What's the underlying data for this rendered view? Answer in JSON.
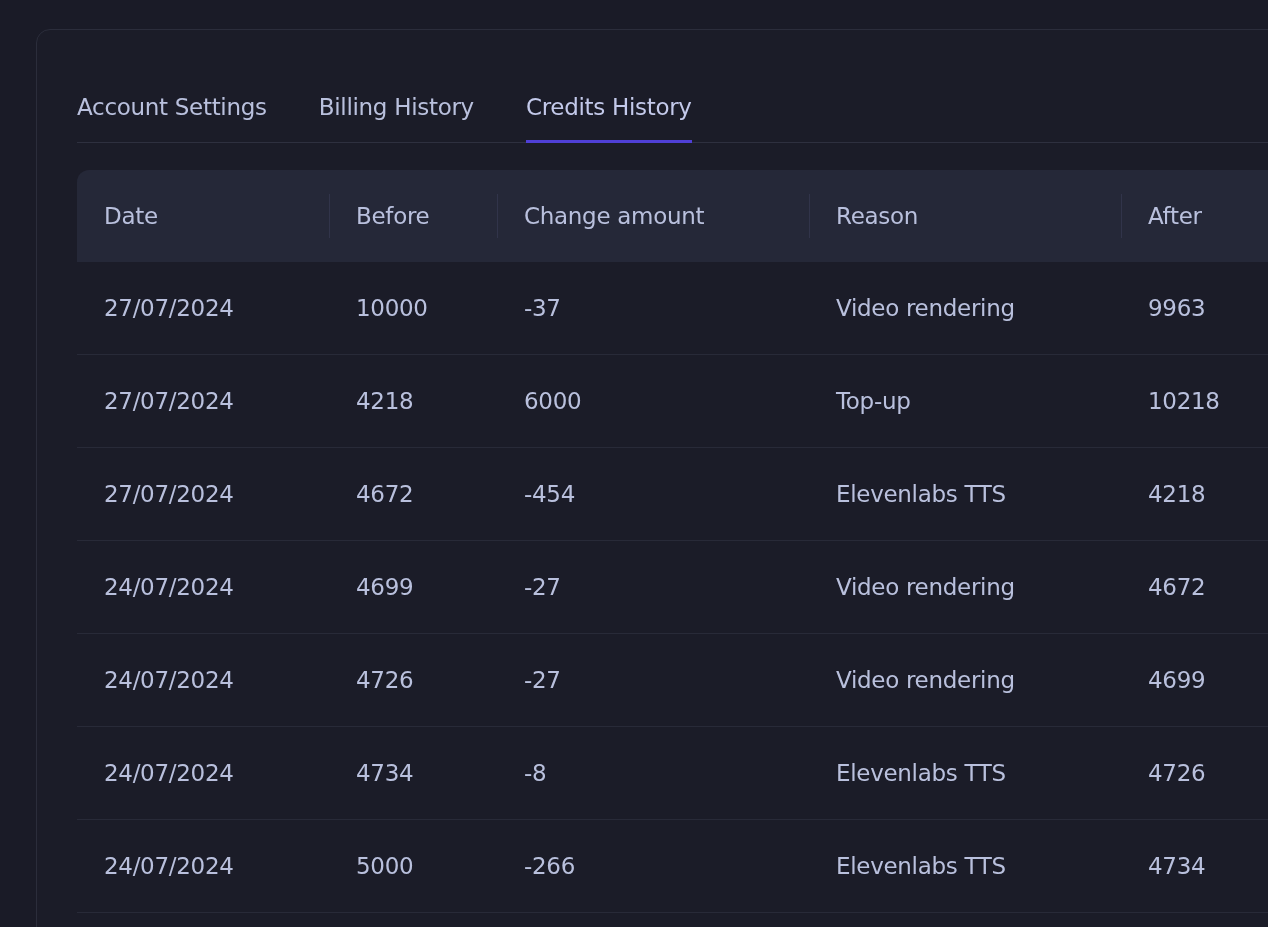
{
  "tabs": [
    {
      "label": "Account Settings",
      "selected": false
    },
    {
      "label": "Billing History",
      "selected": false
    },
    {
      "label": "Credits History",
      "selected": true
    }
  ],
  "table": {
    "columns": [
      "Date",
      "Before",
      "Change amount",
      "Reason",
      "After"
    ],
    "rows": [
      [
        "27/07/2024",
        "10000",
        "-37",
        "Video rendering",
        "9963"
      ],
      [
        "27/07/2024",
        "4218",
        "6000",
        "Top-up",
        "10218"
      ],
      [
        "27/07/2024",
        "4672",
        "-454",
        "Elevenlabs TTS",
        "4218"
      ],
      [
        "24/07/2024",
        "4699",
        "-27",
        "Video rendering",
        "4672"
      ],
      [
        "24/07/2024",
        "4726",
        "-27",
        "Video rendering",
        "4699"
      ],
      [
        "24/07/2024",
        "4734",
        "-8",
        "Elevenlabs TTS",
        "4726"
      ],
      [
        "24/07/2024",
        "5000",
        "-266",
        "Elevenlabs TTS",
        "4734"
      ]
    ]
  }
}
